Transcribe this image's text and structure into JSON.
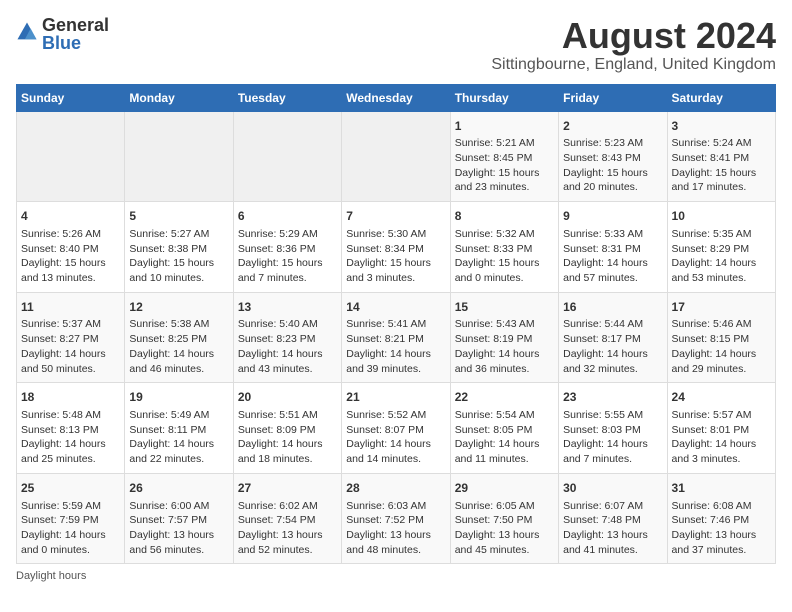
{
  "logo": {
    "general": "General",
    "blue": "Blue"
  },
  "title": "August 2024",
  "location": "Sittingbourne, England, United Kingdom",
  "days_of_week": [
    "Sunday",
    "Monday",
    "Tuesday",
    "Wednesday",
    "Thursday",
    "Friday",
    "Saturday"
  ],
  "weeks": [
    [
      {
        "day": "",
        "info": ""
      },
      {
        "day": "",
        "info": ""
      },
      {
        "day": "",
        "info": ""
      },
      {
        "day": "",
        "info": ""
      },
      {
        "day": "1",
        "info": "Sunrise: 5:21 AM\nSunset: 8:45 PM\nDaylight: 15 hours\nand 23 minutes."
      },
      {
        "day": "2",
        "info": "Sunrise: 5:23 AM\nSunset: 8:43 PM\nDaylight: 15 hours\nand 20 minutes."
      },
      {
        "day": "3",
        "info": "Sunrise: 5:24 AM\nSunset: 8:41 PM\nDaylight: 15 hours\nand 17 minutes."
      }
    ],
    [
      {
        "day": "4",
        "info": "Sunrise: 5:26 AM\nSunset: 8:40 PM\nDaylight: 15 hours\nand 13 minutes."
      },
      {
        "day": "5",
        "info": "Sunrise: 5:27 AM\nSunset: 8:38 PM\nDaylight: 15 hours\nand 10 minutes."
      },
      {
        "day": "6",
        "info": "Sunrise: 5:29 AM\nSunset: 8:36 PM\nDaylight: 15 hours\nand 7 minutes."
      },
      {
        "day": "7",
        "info": "Sunrise: 5:30 AM\nSunset: 8:34 PM\nDaylight: 15 hours\nand 3 minutes."
      },
      {
        "day": "8",
        "info": "Sunrise: 5:32 AM\nSunset: 8:33 PM\nDaylight: 15 hours\nand 0 minutes."
      },
      {
        "day": "9",
        "info": "Sunrise: 5:33 AM\nSunset: 8:31 PM\nDaylight: 14 hours\nand 57 minutes."
      },
      {
        "day": "10",
        "info": "Sunrise: 5:35 AM\nSunset: 8:29 PM\nDaylight: 14 hours\nand 53 minutes."
      }
    ],
    [
      {
        "day": "11",
        "info": "Sunrise: 5:37 AM\nSunset: 8:27 PM\nDaylight: 14 hours\nand 50 minutes."
      },
      {
        "day": "12",
        "info": "Sunrise: 5:38 AM\nSunset: 8:25 PM\nDaylight: 14 hours\nand 46 minutes."
      },
      {
        "day": "13",
        "info": "Sunrise: 5:40 AM\nSunset: 8:23 PM\nDaylight: 14 hours\nand 43 minutes."
      },
      {
        "day": "14",
        "info": "Sunrise: 5:41 AM\nSunset: 8:21 PM\nDaylight: 14 hours\nand 39 minutes."
      },
      {
        "day": "15",
        "info": "Sunrise: 5:43 AM\nSunset: 8:19 PM\nDaylight: 14 hours\nand 36 minutes."
      },
      {
        "day": "16",
        "info": "Sunrise: 5:44 AM\nSunset: 8:17 PM\nDaylight: 14 hours\nand 32 minutes."
      },
      {
        "day": "17",
        "info": "Sunrise: 5:46 AM\nSunset: 8:15 PM\nDaylight: 14 hours\nand 29 minutes."
      }
    ],
    [
      {
        "day": "18",
        "info": "Sunrise: 5:48 AM\nSunset: 8:13 PM\nDaylight: 14 hours\nand 25 minutes."
      },
      {
        "day": "19",
        "info": "Sunrise: 5:49 AM\nSunset: 8:11 PM\nDaylight: 14 hours\nand 22 minutes."
      },
      {
        "day": "20",
        "info": "Sunrise: 5:51 AM\nSunset: 8:09 PM\nDaylight: 14 hours\nand 18 minutes."
      },
      {
        "day": "21",
        "info": "Sunrise: 5:52 AM\nSunset: 8:07 PM\nDaylight: 14 hours\nand 14 minutes."
      },
      {
        "day": "22",
        "info": "Sunrise: 5:54 AM\nSunset: 8:05 PM\nDaylight: 14 hours\nand 11 minutes."
      },
      {
        "day": "23",
        "info": "Sunrise: 5:55 AM\nSunset: 8:03 PM\nDaylight: 14 hours\nand 7 minutes."
      },
      {
        "day": "24",
        "info": "Sunrise: 5:57 AM\nSunset: 8:01 PM\nDaylight: 14 hours\nand 3 minutes."
      }
    ],
    [
      {
        "day": "25",
        "info": "Sunrise: 5:59 AM\nSunset: 7:59 PM\nDaylight: 14 hours\nand 0 minutes."
      },
      {
        "day": "26",
        "info": "Sunrise: 6:00 AM\nSunset: 7:57 PM\nDaylight: 13 hours\nand 56 minutes."
      },
      {
        "day": "27",
        "info": "Sunrise: 6:02 AM\nSunset: 7:54 PM\nDaylight: 13 hours\nand 52 minutes."
      },
      {
        "day": "28",
        "info": "Sunrise: 6:03 AM\nSunset: 7:52 PM\nDaylight: 13 hours\nand 48 minutes."
      },
      {
        "day": "29",
        "info": "Sunrise: 6:05 AM\nSunset: 7:50 PM\nDaylight: 13 hours\nand 45 minutes."
      },
      {
        "day": "30",
        "info": "Sunrise: 6:07 AM\nSunset: 7:48 PM\nDaylight: 13 hours\nand 41 minutes."
      },
      {
        "day": "31",
        "info": "Sunrise: 6:08 AM\nSunset: 7:46 PM\nDaylight: 13 hours\nand 37 minutes."
      }
    ]
  ],
  "footer": "Daylight hours"
}
